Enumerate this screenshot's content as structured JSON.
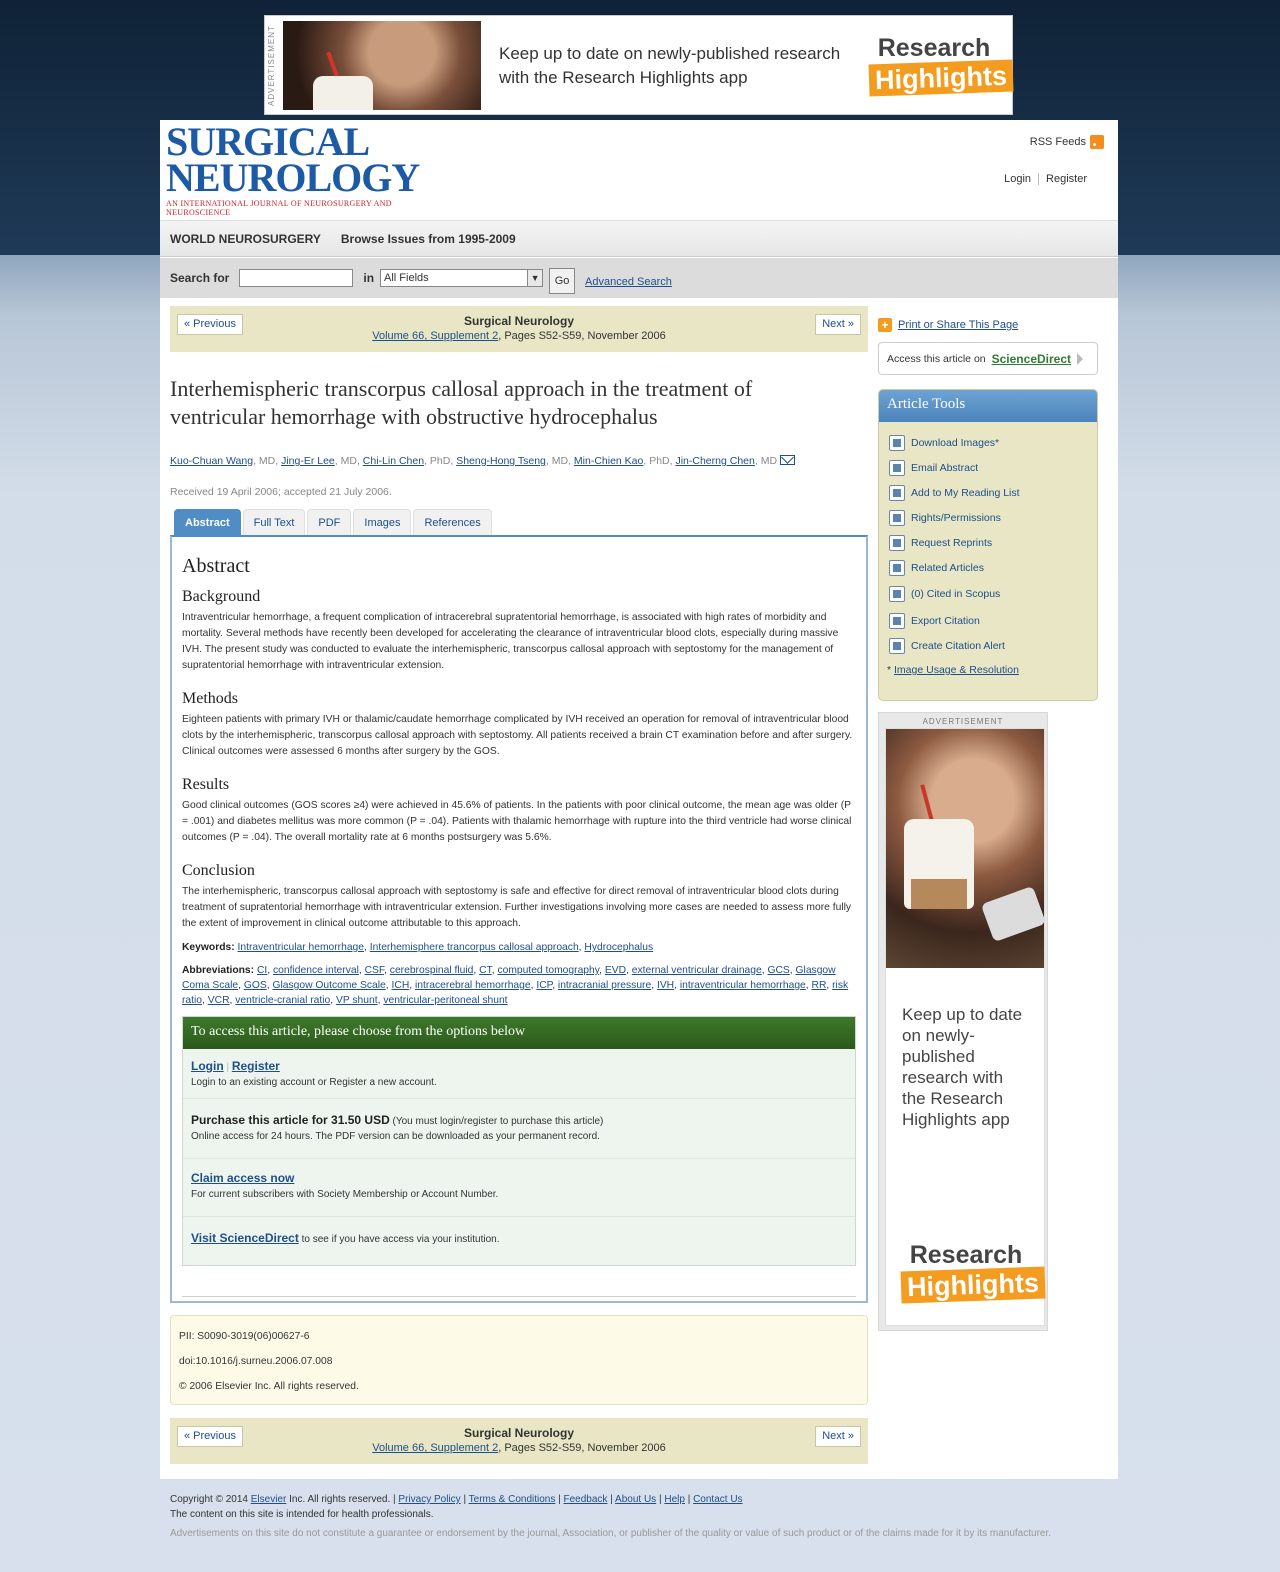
{
  "top_ad": {
    "label": "ADVERTISEMENT",
    "text": "Keep up to date on newly-published research with the Research Highlights app",
    "logo_line1": "Research",
    "logo_line2": "Highlights"
  },
  "header": {
    "logo_line1": "SURGICAL",
    "logo_line2": "NEUROLOGY",
    "logo_tagline": "AN INTERNATIONAL JOURNAL OF NEUROSURGERY AND NEUROSCIENCE",
    "rss": "RSS Feeds",
    "login": "Login",
    "register": "Register"
  },
  "nav": {
    "item1": "WORLD NEUROSURGERY",
    "item2": "Browse Issues from 1995-2009"
  },
  "search": {
    "label": "Search for",
    "in_label": "in",
    "select_value": "All Fields",
    "go": "Go",
    "advanced": "Advanced Search"
  },
  "issue_nav": {
    "prev": "« Previous",
    "next": "Next »",
    "journal": "Surgical Neurology",
    "volume_link": "Volume 66, Supplement 2",
    "pages": ", Pages S52-S59, November 2006"
  },
  "article": {
    "title": "Interhemispheric transcorpus callosal approach in the treatment of ventricular hemorrhage with obstructive hydrocephalus",
    "authors": [
      {
        "name": "Kuo-Chuan Wang",
        "degree": ", MD, "
      },
      {
        "name": "Jing-Er Lee",
        "degree": ", MD, "
      },
      {
        "name": "Chi-Lin Chen",
        "degree": ", PhD, "
      },
      {
        "name": "Sheng-Hong Tseng",
        "degree": ", MD, "
      },
      {
        "name": "Min-Chien Kao",
        "degree": ", PhD, "
      },
      {
        "name": "Jin-Cherng Chen",
        "degree": ", MD"
      }
    ],
    "received": "Received 19 April 2006; accepted 21 July 2006.",
    "tabs": [
      "Abstract",
      "Full Text",
      "PDF",
      "Images",
      "References"
    ],
    "abstract_heading": "Abstract",
    "sections": [
      {
        "heading": "Background",
        "text": "Intraventricular hemorrhage, a frequent complication of intracerebral supratentorial hemorrhage, is associated with high rates of morbidity and mortality. Several methods have recently been developed for accelerating the clearance of intraventricular blood clots, especially during massive IVH. The present study was conducted to evaluate the interhemispheric, transcorpus callosal approach with septostomy for the management of supratentorial hemorrhage with intraventricular extension."
      },
      {
        "heading": "Methods",
        "text": "Eighteen patients with primary IVH or thalamic/caudate hemorrhage complicated by IVH received an operation for removal of intraventricular blood clots by the interhemispheric, transcorpus callosal approach with septostomy. All patients received a brain CT examination before and after surgery. Clinical outcomes were assessed 6 months after surgery by the GOS."
      },
      {
        "heading": "Results",
        "text": "Good clinical outcomes (GOS scores ≥4) were achieved in 45.6% of patients. In the patients with poor clinical outcome, the mean age was older (P = .001) and diabetes mellitus was more common (P = .04). Patients with thalamic hemorrhage with rupture into the third ventricle had worse clinical outcomes (P = .04). The overall mortality rate at 6 months postsurgery was 5.6%."
      },
      {
        "heading": "Conclusion",
        "text": "The interhemispheric, transcorpus callosal approach with septostomy is safe and effective for direct removal of intraventricular blood clots during treatment of supratentorial hemorrhage with intraventricular extension. Further investigations involving more cases are needed to assess more fully the extent of improvement in clinical outcome attributable to this approach."
      }
    ],
    "keywords_label": "Keywords:",
    "keywords": [
      "Intraventricular hemorrhage",
      "Interhemisphere trancorpus callosal approach",
      "Hydrocephalus"
    ],
    "abbrev_label": "Abbreviations:",
    "abbreviations": [
      "CI",
      "confidence interval",
      "CSF",
      "cerebrospinal fluid",
      "CT",
      "computed tomography",
      "EVD",
      "external ventricular drainage",
      "GCS",
      "Glasgow Coma Scale",
      "GOS",
      "Glasgow Outcome Scale",
      "ICH",
      "intracerebral hemorrhage",
      "ICP",
      "intracranial pressure",
      "IVH",
      "intraventricular hemorrhage",
      "RR",
      "risk ratio",
      "VCR",
      "ventricle-cranial ratio",
      "VP shunt",
      "ventricular-peritoneal shunt"
    ]
  },
  "access": {
    "heading": "To access this article, please choose from the options below",
    "login": "Login",
    "register": "Register",
    "login_desc": "Login to an existing account or Register a new account.",
    "purchase": "Purchase this article for 31.50 USD",
    "purchase_note": " (You must login/register to purchase this article)",
    "purchase_desc": "Online access for 24 hours. The PDF version can be downloaded as your permanent record.",
    "claim": "Claim access now",
    "claim_desc": "For current subscribers with Society Membership or Account Number.",
    "visit": "Visit ScienceDirect",
    "visit_desc": " to see if you have access via your institution."
  },
  "pii": {
    "pii": "PII: S0090-3019(06)00627-6",
    "doi": "doi:10.1016/j.surneu.2006.07.008",
    "copyright": "© 2006 Elsevier Inc. All rights reserved."
  },
  "sidebar": {
    "print": "Print or Share This Page",
    "access_on": "Access this article on",
    "sciencedirect": "ScienceDirect",
    "tools_title": "Article Tools",
    "tools": [
      {
        "label": "Download Images*",
        "icon": "image-download-icon"
      },
      {
        "label": "Email Abstract",
        "icon": "email-icon"
      },
      {
        "label": "Add to My Reading List",
        "icon": "reading-list-icon"
      },
      {
        "label": "Rights/Permissions",
        "icon": "lock-icon"
      },
      {
        "label": "Request Reprints",
        "icon": "reprint-icon"
      },
      {
        "label": "Related Articles",
        "icon": "related-articles-icon"
      },
      {
        "label": "(0) Cited in Scopus",
        "icon": "scopus-icon"
      },
      {
        "label": "Export Citation",
        "icon": "export-icon"
      },
      {
        "label": "Create Citation Alert",
        "icon": "alert-icon"
      }
    ],
    "image_usage_prefix": "* ",
    "image_usage": "Image Usage & Resolution",
    "ad_label": "ADVERTISEMENT",
    "ad_text": "Keep up to date on newly-published research with the Research Highlights app",
    "ad_logo1": "Research",
    "ad_logo2": "Highlights"
  },
  "footer": {
    "copyright_pre": "Copyright © 2014 ",
    "elsevier": "Elsevier",
    "copyright_post": " Inc. All rights reserved. | ",
    "links": [
      "Privacy Policy",
      "Terms & Conditions",
      "Feedback",
      "About Us",
      "Help",
      "Contact Us"
    ],
    "health": "The content on this site is intended for health professionals.",
    "disclaimer": "Advertisements on this site do not constitute a guarantee or endorsement by the journal, Association, or publisher of the quality or value of such product or of the claims made for it by its manufacturer."
  }
}
